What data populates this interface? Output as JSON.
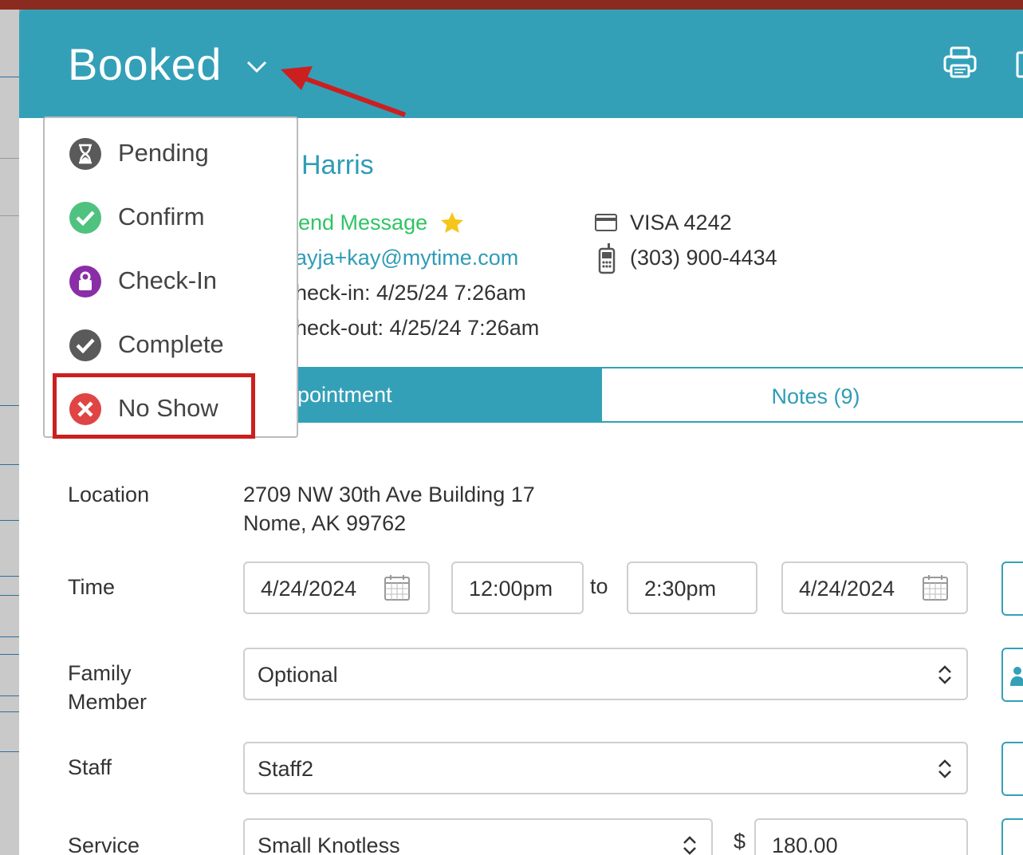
{
  "header": {
    "status": "Booked",
    "print_icon": "printer-icon"
  },
  "status_menu": {
    "items": [
      {
        "label": "Pending",
        "icon": "hourglass-icon",
        "color": "#5a5a5a"
      },
      {
        "label": "Confirm",
        "icon": "check-circle-icon",
        "color": "#4fc27f"
      },
      {
        "label": "Check-In",
        "icon": "person-lock-icon",
        "color": "#8a2ea8"
      },
      {
        "label": "Complete",
        "icon": "check-circle-icon",
        "color": "#5a5a5a"
      },
      {
        "label": "No Show",
        "icon": "x-circle-icon",
        "color": "#e04444"
      }
    ],
    "highlighted": "No Show"
  },
  "customer": {
    "name": "Harris",
    "send_message": "end Message",
    "email": "ayja+kay@mytime.com",
    "check_in": "heck-in: 4/25/24 7:26am",
    "check_out": "heck-out: 4/25/24 7:26am",
    "card": "VISA 4242",
    "phone": "(303) 900-4434"
  },
  "tabs": {
    "appointment": "pointment",
    "notes": "Notes (9)"
  },
  "form": {
    "location_label": "Location",
    "location_line1": "2709 NW 30th Ave Building 17",
    "location_line2": "Nome, AK 99762",
    "time_label": "Time",
    "start_date": "4/24/2024",
    "start_time": "12:00pm",
    "to": "to",
    "end_time": "2:30pm",
    "end_date": "4/24/2024",
    "family_label_1": "Family",
    "family_label_2": "Member",
    "family_value": "Optional",
    "staff_label": "Staff",
    "staff_value": "Staff2",
    "service_label": "Service",
    "service_value": "Small Knotless",
    "currency": "$",
    "price": "180.00"
  },
  "colors": {
    "accent": "#33a0b8",
    "annotation": "#cc1f1f"
  }
}
